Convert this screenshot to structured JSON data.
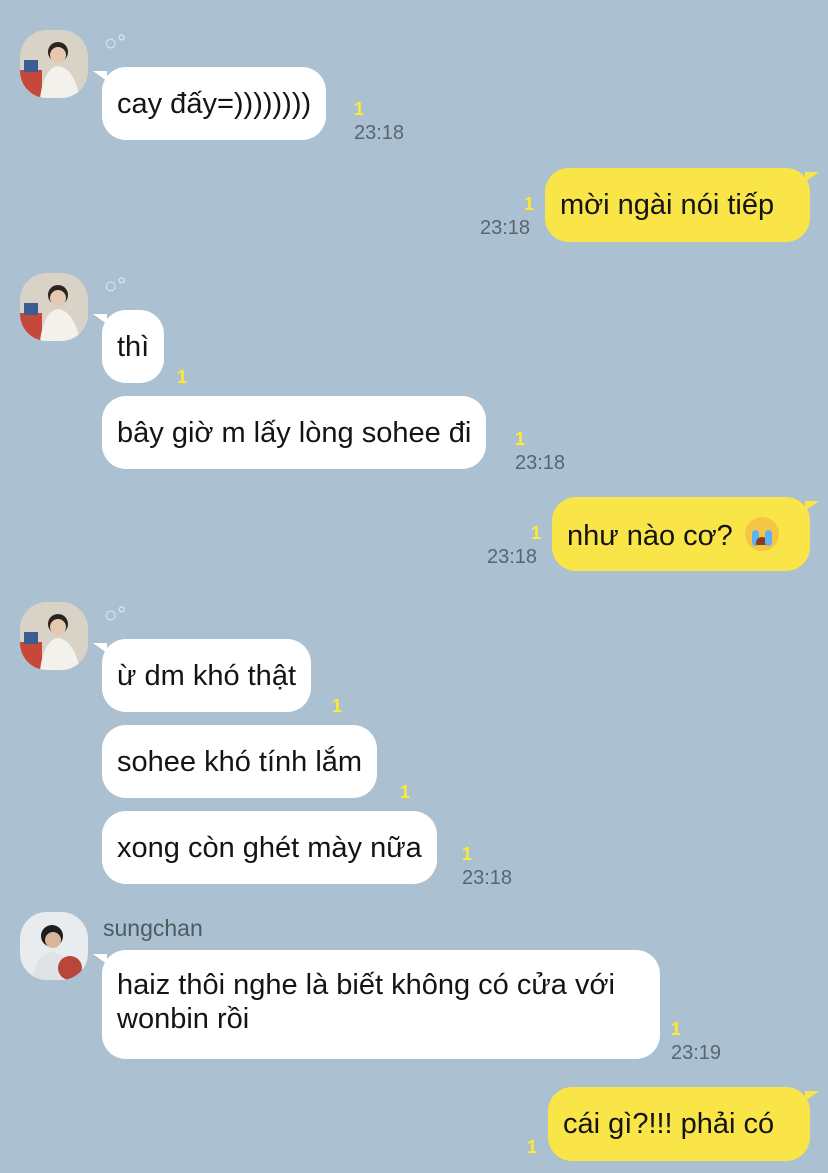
{
  "chat": {
    "sender_icon": "bubbles-icon",
    "sender2_name": "sungchan",
    "messages": [
      {
        "text": "cay đấy=))))))))",
        "unread": "1",
        "time": "23:18"
      },
      {
        "text": "mời ngài nói tiếp",
        "unread": "1",
        "time": "23:18"
      },
      {
        "text": "thì",
        "unread": "1"
      },
      {
        "text": "bây giờ m lấy lòng sohee đi",
        "unread": "1",
        "time": "23:18"
      },
      {
        "text": "như nào cơ?",
        "emoji": "loudly-crying-face",
        "unread": "1",
        "time": "23:18"
      },
      {
        "text": "ừ dm khó thật",
        "unread": "1"
      },
      {
        "text": "sohee khó tính lắm",
        "unread": "1"
      },
      {
        "text": "xong còn ghét mày nữa",
        "unread": "1",
        "time": "23:18"
      },
      {
        "text": "haiz thôi nghe là biết không có cửa với wonbin rồi",
        "unread": "1",
        "time": "23:19"
      },
      {
        "text": "cái gì?!!! phải có",
        "unread": "1"
      }
    ]
  },
  "colors": {
    "background": "#abc1d1",
    "incoming_bubble": "#ffffff",
    "outgoing_bubble": "#f9e547",
    "unread_count": "#ffea2e"
  }
}
